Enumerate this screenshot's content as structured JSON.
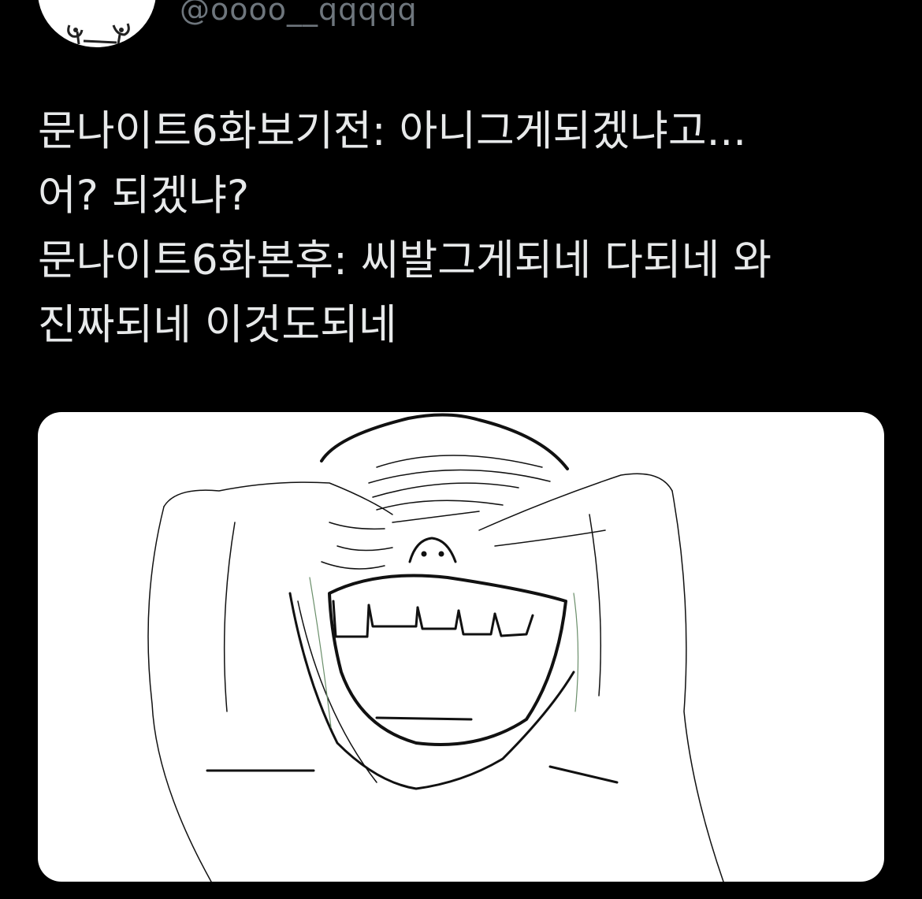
{
  "tweet": {
    "author": {
      "handle": "@oooo__qqqqq",
      "avatar_icon": "doodle-face-avatar"
    },
    "text_lines": [
      "문나이트6화보기전: 아니그게되겠냐고...",
      "어? 되겠냐?",
      "문나이트6화본후: 씨발그게되네 다되네 와",
      "진짜되네 이것도되네"
    ],
    "media": {
      "type": "image",
      "icon": "meme-face-hands-over-eyes"
    }
  },
  "colors": {
    "background": "#000000",
    "text": "#e7e9ea",
    "secondary_text": "#6e767d",
    "media_background": "#ffffff"
  }
}
